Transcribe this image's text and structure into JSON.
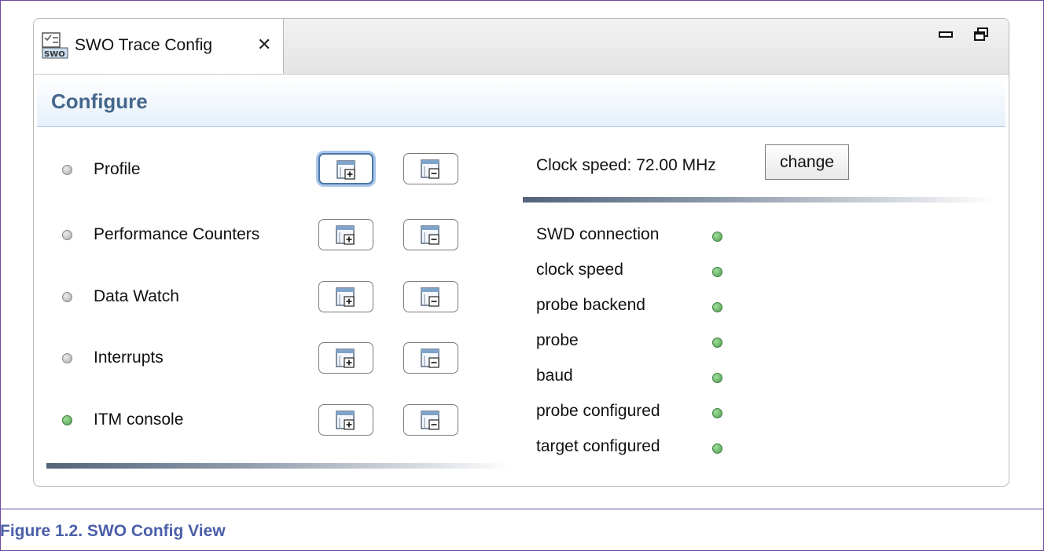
{
  "tab": {
    "title": "SWO Trace Config",
    "close_glyph": "⮽"
  },
  "header": {
    "title": "Configure"
  },
  "left_items": [
    {
      "label": "Profile",
      "status": "inactive",
      "status_color": "#aaaaaa"
    },
    {
      "label": "Performance Counters",
      "status": "inactive",
      "status_color": "#aaaaaa"
    },
    {
      "label": "Data Watch",
      "status": "inactive",
      "status_color": "#aaaaaa"
    },
    {
      "label": "Interrupts",
      "status": "inactive",
      "status_color": "#aaaaaa"
    },
    {
      "label": "ITM console",
      "status": "active",
      "status_color": "#5aa65a"
    }
  ],
  "clock": {
    "label": "Clock speed: 72.00 MHz",
    "change_label": "change"
  },
  "status_items": [
    {
      "label": "SWD connection",
      "status": "ok"
    },
    {
      "label": "clock speed",
      "status": "ok"
    },
    {
      "label": "probe backend",
      "status": "ok"
    },
    {
      "label": "probe",
      "status": "ok"
    },
    {
      "label": "baud",
      "status": "ok"
    },
    {
      "label": "probe configured",
      "status": "ok"
    },
    {
      "label": "target configured",
      "status": "ok"
    }
  ],
  "colors": {
    "accent": "#46678c",
    "ok": "#5aa65a",
    "inactive": "#aaaaaa",
    "caption": "#4a5fa8"
  },
  "caption": "Figure 1.2. SWO Config View"
}
